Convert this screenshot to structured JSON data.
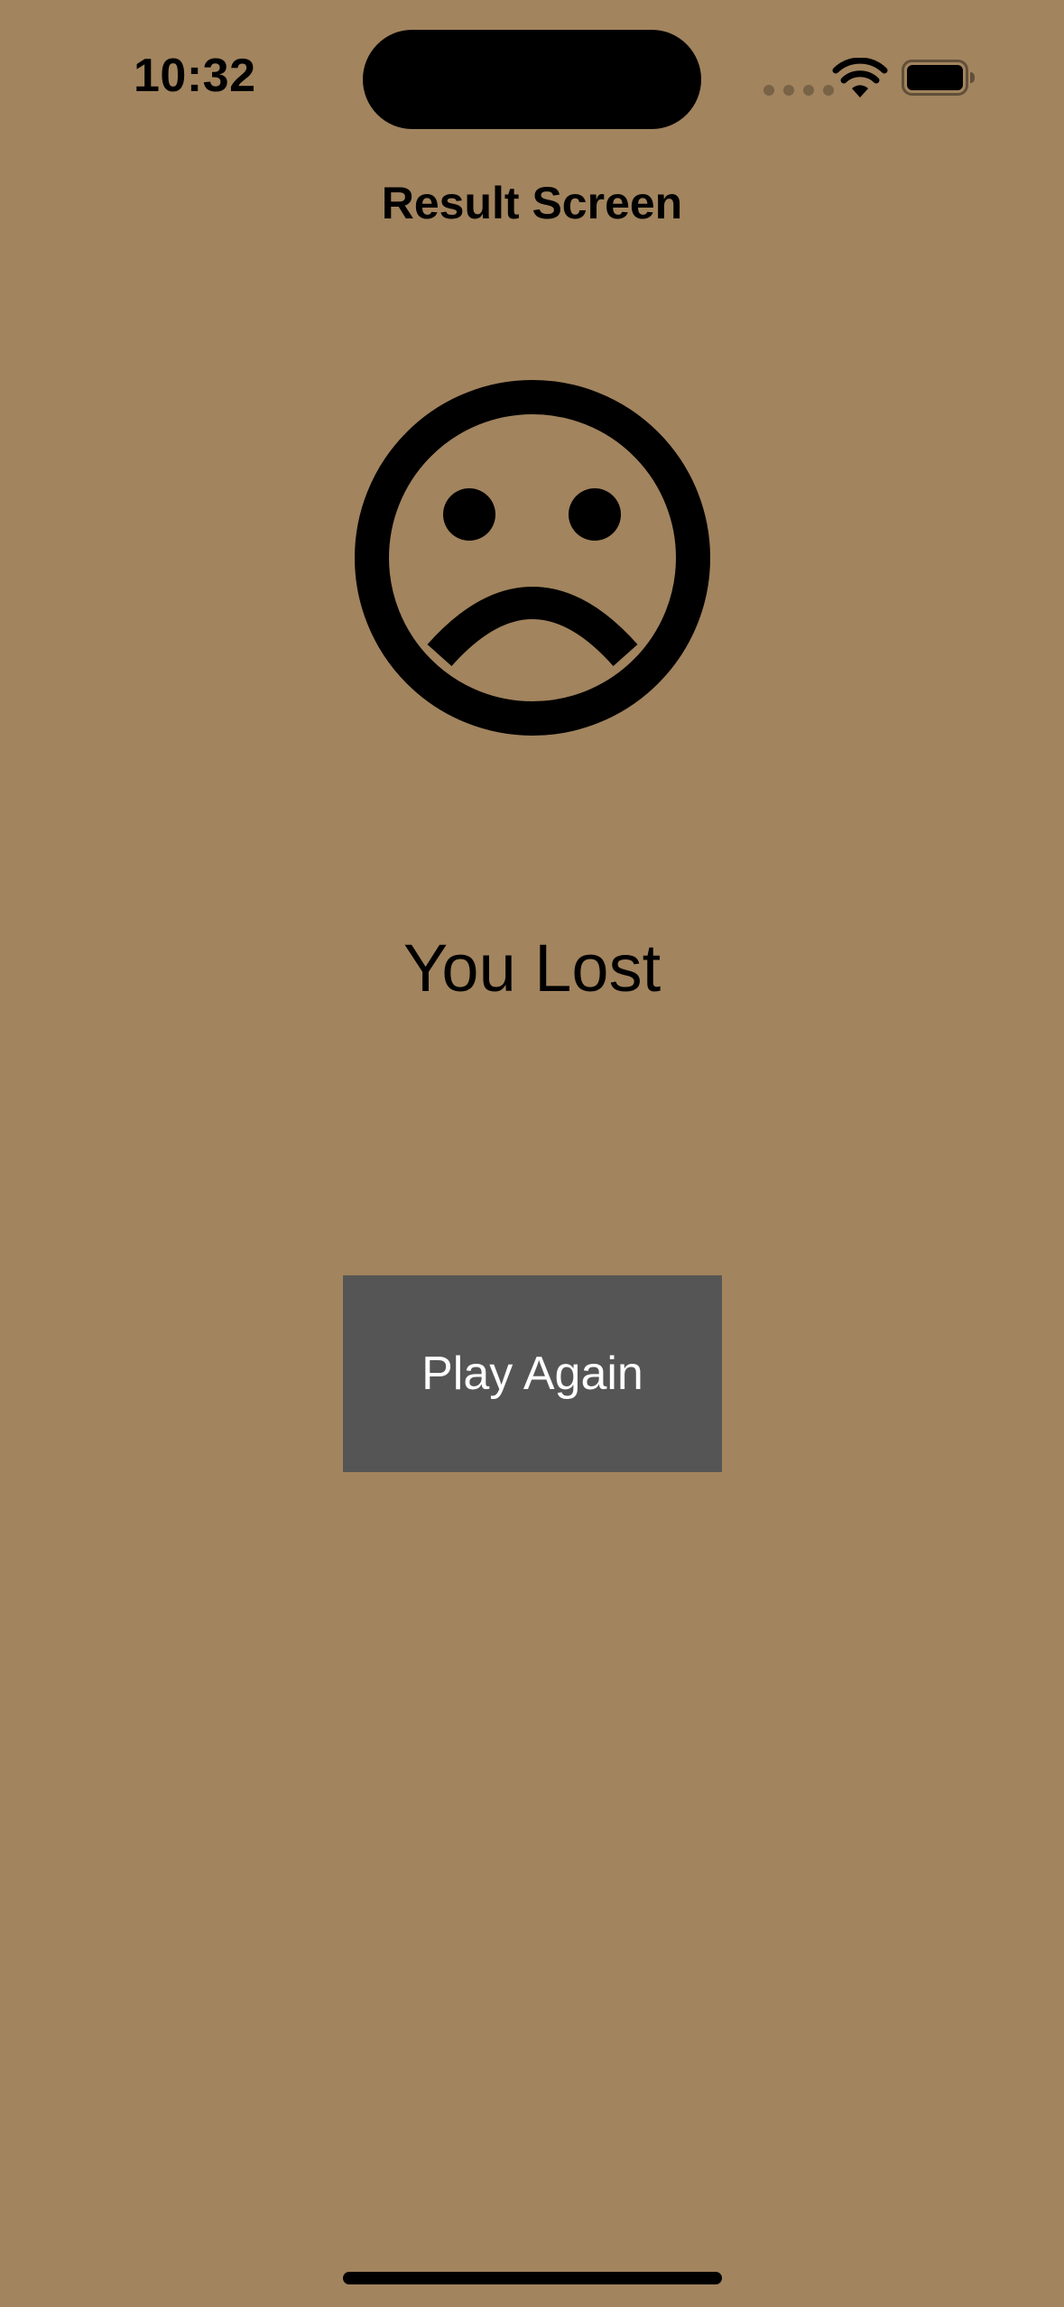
{
  "status_bar": {
    "time": "10:32",
    "icons": [
      "signal-icon",
      "wifi-icon",
      "battery-icon"
    ]
  },
  "nav": {
    "title": "Result Screen"
  },
  "result": {
    "icon": "sad-face-icon",
    "message": "You Lost"
  },
  "actions": {
    "play_again_label": "Play Again"
  },
  "colors": {
    "background": "#a2845e",
    "button_background": "#555555",
    "button_text": "#ffffff",
    "text": "#000000"
  }
}
